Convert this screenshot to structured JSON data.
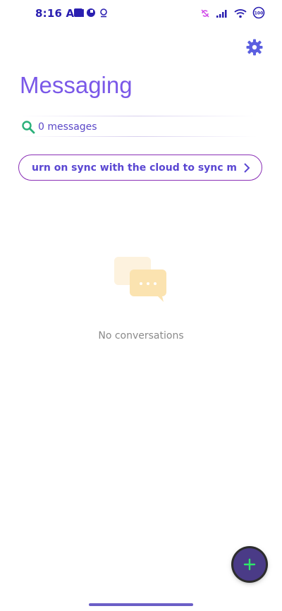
{
  "status_bar": {
    "time": "8:16 AM",
    "battery": "100"
  },
  "header": {
    "title": "Messaging"
  },
  "search": {
    "count_text": "0 messages"
  },
  "sync_banner": {
    "text": "urn on sync with the cloud to sync messag"
  },
  "empty_state": {
    "text": "No conversations"
  },
  "colors": {
    "accent": "#7a58e8",
    "fab": "#4a3b87",
    "search_icon": "#2ab07a",
    "banner_border": "#8a2fb6"
  }
}
